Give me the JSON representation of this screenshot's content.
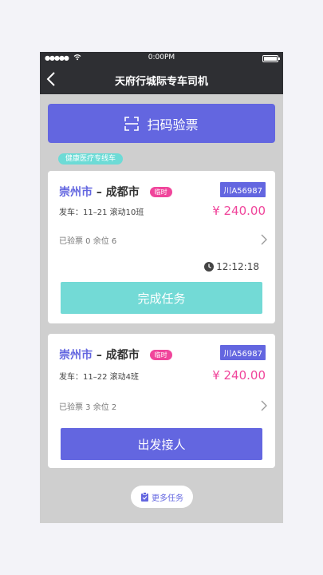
{
  "status_bar": {
    "signal": "●●●●●",
    "time": "0:00PM"
  },
  "header": {
    "title": "天府行城际专车司机"
  },
  "scan": {
    "label": "扫码验票"
  },
  "category_tag": "健康医疗专线车",
  "trips": [
    {
      "from": "崇州市",
      "separator": "–",
      "to": "成都市",
      "badge": "临时",
      "plate": "川A56987",
      "depart": "发车：11–21 滚动10班",
      "price": "¥ 240.00",
      "tickets": "已验票 0  余位 6",
      "timer": "12:12:18",
      "action": "完成任务"
    },
    {
      "from": "崇州市",
      "separator": "–",
      "to": "成都市",
      "badge": "临时",
      "plate": "川A56987",
      "depart": "发车：11–22 滚动4班",
      "price": "¥ 240.00",
      "tickets": "已验票 3  余位 2",
      "action": "出发接人"
    }
  ],
  "more": {
    "label": "更多任务"
  },
  "colors": {
    "primary": "#6366e0",
    "teal": "#73dad6",
    "pink": "#f0459b",
    "nav_bg": "#2e2f33"
  }
}
